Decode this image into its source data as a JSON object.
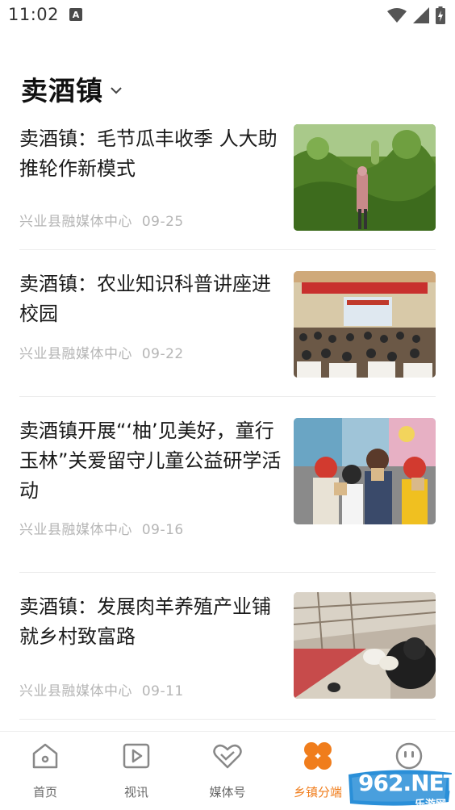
{
  "status_bar": {
    "time": "11:02",
    "notif_icon": "A"
  },
  "header": {
    "title": "卖酒镇"
  },
  "news": [
    {
      "title": "卖酒镇：毛节瓜丰收季 人大助推轮作新模式",
      "source": "兴业县融媒体中心",
      "date": "09-25",
      "thumb": "farm-harvest-photo"
    },
    {
      "title": "卖酒镇：农业知识科普讲座进校园",
      "source": "兴业县融媒体中心",
      "date": "09-22",
      "thumb": "lecture-hall-photo"
    },
    {
      "title": "卖酒镇开展“‘柚’见美好，童行玉林”关爱留守儿童公益研学活动",
      "source": "兴业县融媒体中心",
      "date": "09-16",
      "thumb": "children-activity-photo"
    },
    {
      "title": "卖酒镇：发展肉羊养殖产业铺就乡村致富路",
      "source": "兴业县融媒体中心",
      "date": "09-11",
      "thumb": "goat-farm-photo"
    }
  ],
  "nav": [
    {
      "label": "首页",
      "icon": "home-icon",
      "active": false
    },
    {
      "label": "视讯",
      "icon": "video-icon",
      "active": false
    },
    {
      "label": "媒体号",
      "icon": "heart-icon",
      "active": false
    },
    {
      "label": "乡镇分端",
      "icon": "clover-icon",
      "active": true
    },
    {
      "label": "",
      "icon": "smiley-icon",
      "active": false
    }
  ],
  "watermark": {
    "text": "962.NET",
    "sub": "乐游网"
  },
  "colors": {
    "accent": "#f07d1c",
    "meta": "#b5b5b5"
  }
}
